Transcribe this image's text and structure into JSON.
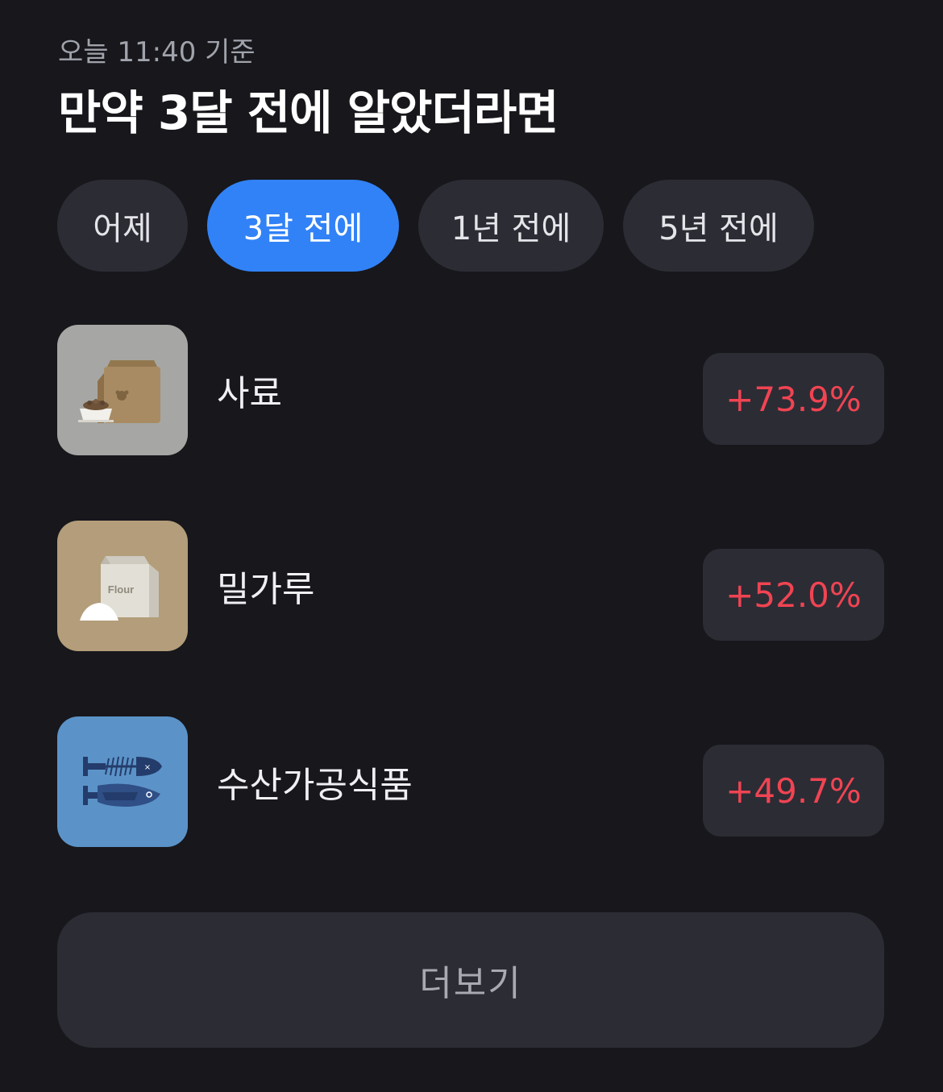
{
  "header": {
    "timestamp": "오늘 11:40 기준",
    "title": "만약 3달 전에 알았더라면"
  },
  "tabs": [
    {
      "label": "어제",
      "active": false
    },
    {
      "label": "3달 전에",
      "active": true
    },
    {
      "label": "1년 전에",
      "active": false
    },
    {
      "label": "5년 전에",
      "active": false
    }
  ],
  "items": [
    {
      "name": "사료",
      "change": "+73.9%",
      "icon": "pet-food-bag-icon",
      "icon_bg": "#a6a7a4"
    },
    {
      "name": "밀가루",
      "change": "+52.0%",
      "icon": "flour-bag-icon",
      "icon_bg": "#b39d7a",
      "icon_text": "Flour"
    },
    {
      "name": "수산가공식품",
      "change": "+49.7%",
      "icon": "fish-icon",
      "icon_bg": "#5b93c8"
    }
  ],
  "more_button": {
    "label": "더보기"
  },
  "colors": {
    "background": "#17171c",
    "accent": "#3182f6",
    "chip": "#2c2c35",
    "positive_change": "#f04452"
  }
}
